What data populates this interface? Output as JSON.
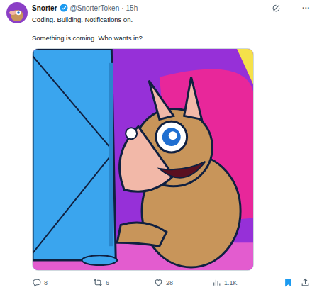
{
  "post": {
    "author": {
      "name": "Snorter",
      "verified": true,
      "handle": "@SnorterToken",
      "separator": "·",
      "time": "15h",
      "bio": "Coding. Building. Notifications on."
    },
    "more": "···",
    "text": "Something is coming. Who wants in?"
  },
  "actions": [
    {
      "kind": "reply",
      "count": "8"
    },
    {
      "kind": "repost",
      "count": "6"
    },
    {
      "kind": "like",
      "count": "28"
    },
    {
      "kind": "views",
      "count": "1.1K"
    }
  ],
  "tools": [
    {
      "kind": "bookmark",
      "active": true
    },
    {
      "kind": "share",
      "active": false
    }
  ]
}
